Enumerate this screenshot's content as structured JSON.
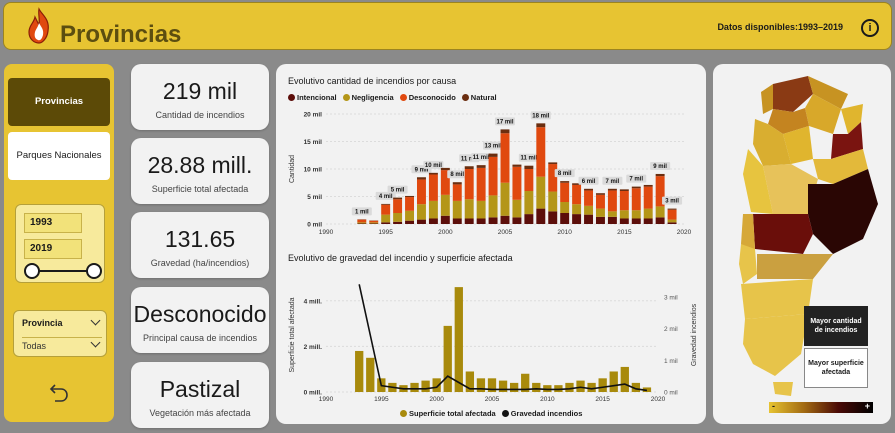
{
  "header": {
    "title": "Provincias",
    "data_range": "Datos disponibles:1993–2019",
    "info_icon": "i"
  },
  "sidebar": {
    "nav_active": "Provincias",
    "nav_inactive": "Parques Nacionales",
    "year_from": "1993",
    "year_to": "2019",
    "filter_label": "Provincia",
    "filter_value": "Todas"
  },
  "kpis": [
    {
      "value": "219 mil",
      "label": "Cantidad de incendios"
    },
    {
      "value": "28.88 mill.",
      "label": "Superficie total afectada"
    },
    {
      "value": "131.65",
      "label": "Gravedad (ha/incendios)"
    },
    {
      "value": "Desconocido",
      "label": "Principal causa de incendios"
    },
    {
      "value": "Pastizal",
      "label": "Vegetación más afectada"
    }
  ],
  "map": {
    "btn_max_count": "Mayor cantidad de incendios",
    "btn_max_area": "Mayor superficie afectada",
    "scale_min": "-",
    "scale_max": "+"
  },
  "chart_data": [
    {
      "type": "bar",
      "title": "Evolutivo cantidad de incendios por causa",
      "ylabel": "Cantidad",
      "ylim": [
        0,
        20
      ],
      "yticks": [
        "0 mil",
        "5 mil",
        "10 mil",
        "15 mil",
        "20 mil"
      ],
      "xticks": [
        "1990",
        "1995",
        "2000",
        "2005",
        "2010",
        "2015",
        "2020"
      ],
      "x": [
        1993,
        1994,
        1995,
        1996,
        1997,
        1998,
        1999,
        2000,
        2001,
        2002,
        2003,
        2004,
        2005,
        2006,
        2007,
        2008,
        2009,
        2010,
        2011,
        2012,
        2013,
        2014,
        2015,
        2016,
        2017,
        2018,
        2019
      ],
      "totals_labels": [
        "1 mil",
        "",
        "4 mil",
        "5 mil",
        "",
        "9 mil",
        "10 mil",
        "",
        "8 mil",
        "11 mil",
        "11 mil",
        "13 mil",
        "17 mil",
        "",
        "11 mil",
        "18 mil",
        "",
        "8 mil",
        "",
        "6 mil",
        "",
        "7 mil",
        "",
        "7 mil",
        "",
        "9 mil",
        "3 mil"
      ],
      "series": [
        {
          "name": "Intencional",
          "color": "#5c0e0a",
          "values": [
            0.1,
            0.1,
            0.3,
            0.4,
            0.6,
            0.8,
            1.0,
            1.5,
            1.0,
            1.0,
            1.0,
            1.2,
            1.5,
            1.2,
            1.8,
            2.8,
            2.3,
            2.0,
            1.8,
            1.7,
            1.3,
            1.3,
            1.0,
            1.0,
            1.0,
            1.2,
            0.3
          ]
        },
        {
          "name": "Negligencia",
          "color": "#b49618",
          "values": [
            0.2,
            0.2,
            1.4,
            1.6,
            1.8,
            2.8,
            3.2,
            3.8,
            3.2,
            3.5,
            3.2,
            4.0,
            6.0,
            3.2,
            4.2,
            5.8,
            3.6,
            2.0,
            1.8,
            1.6,
            1.5,
            1.0,
            1.5,
            1.5,
            1.8,
            2.0,
            0.5
          ]
        },
        {
          "name": "Desconocido",
          "color": "#e0490f",
          "values": [
            0.5,
            0.3,
            1.8,
            2.5,
            2.5,
            4.5,
            4.8,
            4.5,
            3.0,
            5.5,
            6.0,
            7.0,
            9.0,
            6.0,
            4.0,
            9.0,
            5.0,
            3.5,
            3.5,
            2.8,
            2.5,
            3.8,
            3.5,
            4.0,
            4.0,
            5.5,
            1.8
          ]
        },
        {
          "name": "Natural",
          "color": "#6b2e10",
          "values": [
            0.05,
            0.05,
            0.15,
            0.3,
            0.2,
            0.4,
            0.3,
            0.4,
            0.4,
            0.5,
            0.5,
            0.6,
            0.7,
            0.4,
            0.6,
            0.7,
            0.3,
            0.3,
            0.3,
            0.3,
            0.3,
            0.3,
            0.3,
            0.3,
            0.3,
            0.4,
            0.2
          ]
        }
      ]
    },
    {
      "type": "bar",
      "title": "Evolutivo de gravedad del incendio y superficie afectada",
      "ylabel": "Superficie total afectada",
      "y2label": "Gravedad incendios",
      "ylim": [
        0,
        5
      ],
      "y2lim": [
        0,
        3.6
      ],
      "yticks": [
        "0 mill.",
        "2 mill.",
        "4 mill."
      ],
      "y2ticks": [
        "0 mil",
        "1 mil",
        "2 mil",
        "3 mil"
      ],
      "xticks": [
        "1990",
        "1995",
        "2000",
        "2005",
        "2010",
        "2015",
        "2020"
      ],
      "x": [
        1993,
        1994,
        1995,
        1996,
        1997,
        1998,
        1999,
        2000,
        2001,
        2002,
        2003,
        2004,
        2005,
        2006,
        2007,
        2008,
        2009,
        2010,
        2011,
        2012,
        2013,
        2014,
        2015,
        2016,
        2017,
        2018,
        2019
      ],
      "series": [
        {
          "name": "Superficie total afectada",
          "color": "#a88a0c",
          "type": "bar",
          "values": [
            1.8,
            1.5,
            0.6,
            0.4,
            0.3,
            0.4,
            0.5,
            0.6,
            2.9,
            4.6,
            0.9,
            0.6,
            0.6,
            0.5,
            0.4,
            0.8,
            0.4,
            0.3,
            0.3,
            0.4,
            0.5,
            0.4,
            0.6,
            0.9,
            1.1,
            0.4,
            0.2
          ]
        },
        {
          "name": "Gravedad incendios",
          "color": "#111111",
          "type": "line",
          "values": [
            3.4,
            1.8,
            0.2,
            0.15,
            0.1,
            0.1,
            0.1,
            0.15,
            0.5,
            0.3,
            0.1,
            0.1,
            0.08,
            0.08,
            0.08,
            0.08,
            0.1,
            0.08,
            0.08,
            0.1,
            0.15,
            0.1,
            0.15,
            0.2,
            0.25,
            0.1,
            0.05
          ]
        }
      ]
    }
  ]
}
